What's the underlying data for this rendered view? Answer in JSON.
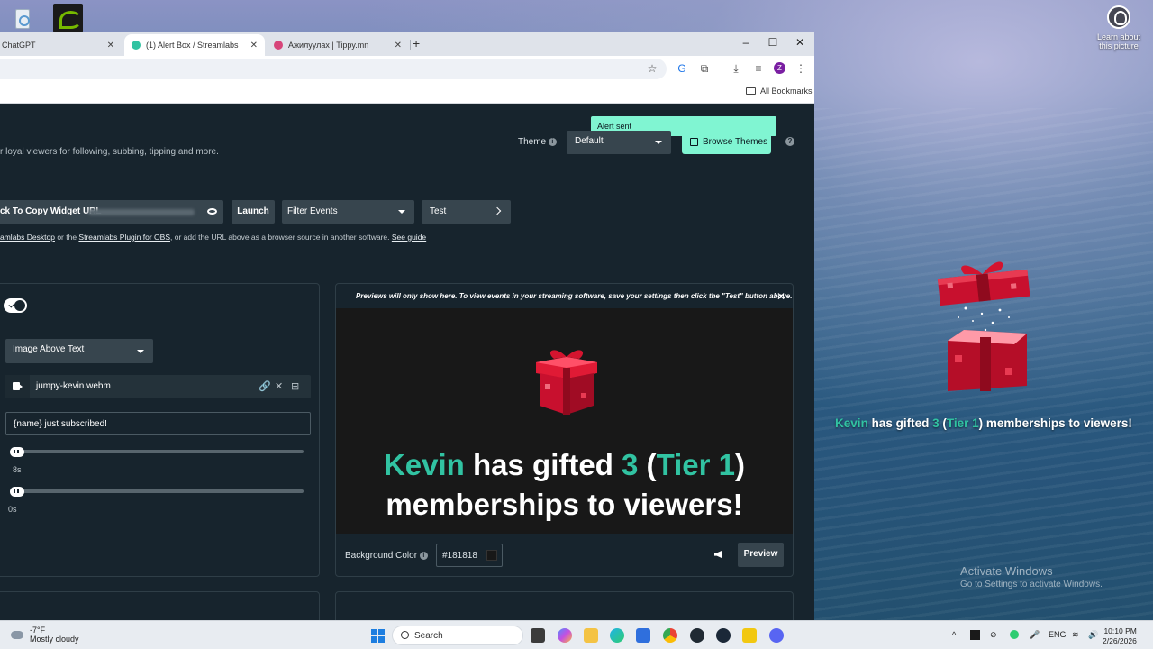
{
  "desktop": {
    "learn_about": "Learn about this picture",
    "activate_title": "Activate Windows",
    "activate_sub": "Go to Settings to activate Windows."
  },
  "overlay_alert": {
    "name": "Kevin",
    "mid1": " has gifted ",
    "count": "3",
    "open": " (",
    "tier": "Tier 1",
    "close": ") memberships to viewers!"
  },
  "browser": {
    "tabs": [
      {
        "label": "ChatGPT"
      },
      {
        "label": "(1) Alert Box / Streamlabs"
      },
      {
        "label": "Ажилуулах | Tippy.mn"
      }
    ],
    "profile_initial": "Z",
    "bookmarks_label": "All Bookmarks"
  },
  "page": {
    "intro": "r loyal viewers for following, subbing, tipping and more.",
    "theme_label": "Theme",
    "theme_value": "Default",
    "browse_themes": "Browse Themes",
    "toast": "Alert sent",
    "widget_url_label": "ck To Copy Widget URL",
    "launch": "Launch",
    "filter_events": "Filter Events",
    "test": "Test",
    "help_line": {
      "link1": "amlabs Desktop",
      "text1": " or the ",
      "link2": "Streamlabs Plugin for OBS",
      "text2": ", or add the URL above as a browser source in another software. ",
      "link3": "See guide"
    }
  },
  "settings": {
    "enabled": true,
    "layout": "Image Above Text",
    "media_file": "jumpy-kevin.webm",
    "message_template": "{name} just subscribed!",
    "duration_label": "8s",
    "duration_fraction": 0.0,
    "delay_label": "0s",
    "delay_fraction": 0.0
  },
  "preview": {
    "note": "Previews will only show here. To view events in your streaming software, save your settings then click the \"Test\" button above.",
    "bg_label": "Background Color",
    "bg_value": "#181818",
    "preview_btn": "Preview"
  },
  "taskbar": {
    "temp": "-7°F",
    "weather": "Mostly cloudy",
    "search": "Search",
    "lang": "ENG",
    "time": "10:10 PM",
    "date": "2/26/2026"
  },
  "colors": {
    "accent": "#80f5d2",
    "highlight": "#31c3a2",
    "panel_bg": "#17242d",
    "stage_bg": "#181818"
  }
}
